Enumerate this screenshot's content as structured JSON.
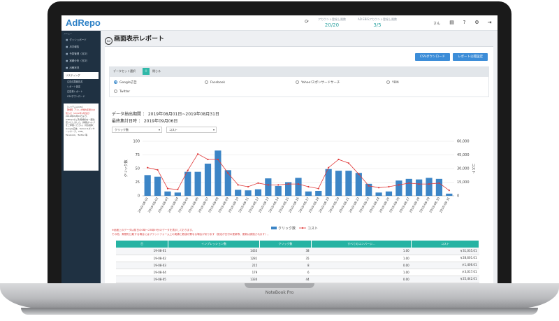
{
  "device": {
    "model_label": "NoteBook Pro"
  },
  "header": {
    "logo": "AdRepo",
    "refresh_icon": "refresh-icon",
    "stats": [
      {
        "label": "アカウント登録上限数",
        "value": "20/20"
      },
      {
        "label": "AD EBiSアカウント登録上限数",
        "value": "3/5"
      }
    ],
    "user_name": "さん",
    "icons": [
      "document-icon",
      "help-icon",
      "gear-icon",
      "logout-icon"
    ]
  },
  "sidebar": {
    "heading": "メニュー",
    "items": [
      {
        "label": "ダッシュボード",
        "icon": "dashboard-icon"
      },
      {
        "label": "月次報告",
        "icon": "report-icon"
      },
      {
        "label": "予算管理（月次）",
        "icon": "budget-icon"
      },
      {
        "label": "実績分析（日次）",
        "icon": "analytics-icon"
      },
      {
        "label": "出稿状況",
        "icon": "chart-icon"
      }
    ],
    "active_item": "リスティング",
    "sub_items": [
      "広告成果報告書",
      "レポート設定",
      "広告費レポート",
      "CSVダウンロード"
    ],
    "news_title": "［システム＆Info］",
    "news_red": "【重要】アドレポ規約変更のお知らせ（2019年9月改訂）",
    "news_body": "2019年09月01日より、AdRepoのご利用規約を一部改定いたしました。詳細はヘルプをご参照ください。対応媒体：Google広告、Yahoo!スポンサードサーチ、YDN、Facebook、Twitter 等"
  },
  "page": {
    "title": "画面表示レポート",
    "buttons": {
      "csv": "CSVダウンロード",
      "publish": "レポート公開設定"
    },
    "preset_label": "データセット選択",
    "preset_toggle": "＋",
    "preset_close": "閉じる",
    "media": [
      {
        "label": "Google広告",
        "selected": true
      },
      {
        "label": "Facebook",
        "selected": false
      },
      {
        "label": "Yahoo!スポンサードサーチ",
        "selected": false
      },
      {
        "label": "YDN",
        "selected": false
      },
      {
        "label": "Twitter",
        "selected": false
      }
    ],
    "period": "データ抽出期間 ： 2019年08月01日~2019年08月31日",
    "updated": "最終集計日時 ： 2019年09月06日",
    "select_left": "クリック数",
    "select_right": "コスト",
    "notes": [
      "※画面上のデータは前日の0時〜23時59分のデータを表示しております。",
      "その他、期間を比較する場合にはプラットフォーム上の実績と数値が異なる場合があります（設定が日付の更新等、更新は実施されます）。"
    ]
  },
  "chart_data": {
    "type": "bar",
    "categories": [
      "2019-08-01",
      "2019-08-02",
      "2019-08-03",
      "2019-08-04",
      "2019-08-05",
      "2019-08-06",
      "2019-08-07",
      "2019-08-08",
      "2019-08-09",
      "2019-08-10",
      "2019-08-11",
      "2019-08-12",
      "2019-08-13",
      "2019-08-14",
      "2019-08-15",
      "2019-08-16",
      "2019-08-17",
      "2019-08-18",
      "2019-08-19",
      "2019-08-20",
      "2019-08-21",
      "2019-08-22",
      "2019-08-23",
      "2019-08-24",
      "2019-08-25",
      "2019-08-26",
      "2019-08-27",
      "2019-08-28",
      "2019-08-29",
      "2019-08-30",
      "2019-08-31"
    ],
    "series": [
      {
        "name": "クリック数",
        "kind": "bar",
        "axis": "left",
        "color": "#3c85c6",
        "values": [
          38,
          35,
          8,
          6,
          44,
          44,
          59,
          83,
          47,
          11,
          10,
          12,
          32,
          18,
          25,
          33,
          8,
          9,
          49,
          46,
          46,
          42,
          22,
          6,
          8,
          28,
          31,
          30,
          33,
          31,
          4
        ]
      },
      {
        "name": "コスト",
        "kind": "line",
        "axis": "right",
        "color": "#e03a3a",
        "values": [
          31000,
          28500,
          8000,
          7000,
          28000,
          46000,
          40000,
          40000,
          25000,
          12000,
          10000,
          14000,
          12000,
          12000,
          13000,
          13000,
          10000,
          8000,
          31000,
          40000,
          36000,
          24000,
          11000,
          9000,
          10000,
          12000,
          14000,
          13000,
          13000,
          14000,
          6000
        ]
      }
    ],
    "yleft": {
      "label": "クリック数",
      "ticks": [
        0,
        25,
        50,
        75,
        100
      ],
      "range": [
        0,
        100
      ]
    },
    "yright": {
      "label": "コスト",
      "ticks": [
        "0",
        "15,000",
        "30,000",
        "45,000",
        "60,000"
      ],
      "range": [
        0,
        60000
      ]
    },
    "legend": "bottom",
    "grid": true
  },
  "table": {
    "headers": [
      "日",
      "インプレッション数",
      "クリック数",
      "すべてのコンバージ…",
      "コスト"
    ],
    "rows": [
      [
        "19-08-01",
        "1433",
        "38",
        "1.00",
        "￥31,035.01"
      ],
      [
        "19-08-02",
        "1281",
        "35",
        "1.00",
        "￥28,601.01"
      ],
      [
        "19-08-03",
        "215",
        "8",
        "0.00",
        "￥1,406.01"
      ],
      [
        "19-08-04",
        "179",
        "6",
        "1.00",
        "￥3,017.01"
      ],
      [
        "19-08-05",
        "1330",
        "44",
        "0.00",
        "￥25,442.01"
      ]
    ]
  }
}
